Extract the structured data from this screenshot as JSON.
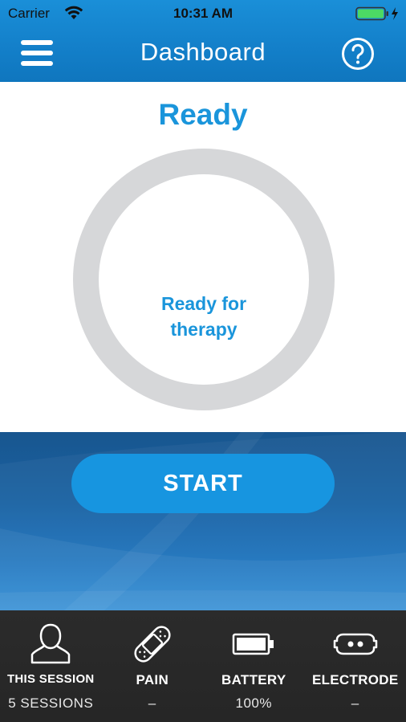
{
  "status_bar": {
    "carrier": "Carrier",
    "time": "10:31 AM"
  },
  "nav": {
    "title": "Dashboard",
    "menu_icon": "hamburger-menu-icon",
    "help_icon": "question-circle-icon"
  },
  "main": {
    "status_title": "Ready",
    "ring_text_line1": "Ready for",
    "ring_text_line2": "therapy",
    "start_label": "START"
  },
  "tabs": [
    {
      "icon": "user-icon",
      "label": "THIS SESSION",
      "value": "5 SESSIONS"
    },
    {
      "icon": "bandage-icon",
      "label": "PAIN",
      "value": "–"
    },
    {
      "icon": "battery-icon",
      "label": "BATTERY",
      "value": "100%"
    },
    {
      "icon": "electrode-icon",
      "label": "ELECTRODE",
      "value": "–"
    }
  ],
  "colors": {
    "accent": "#1a95db",
    "header": "#137fc9",
    "tabbar": "#2b2b2b",
    "ring": "#d6d7d9",
    "battery_green": "#4cd964"
  }
}
